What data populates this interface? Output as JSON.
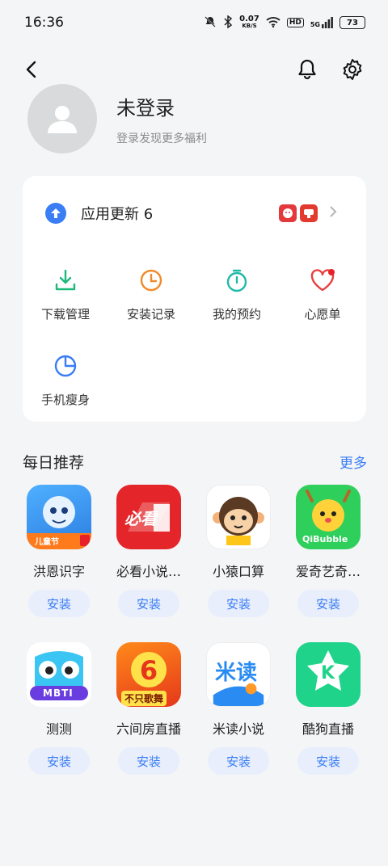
{
  "status": {
    "time": "16:36",
    "net_speed": "0.07",
    "net_unit": "KB/S",
    "hd": "HD",
    "signal": "5G",
    "battery": "73"
  },
  "profile": {
    "title": "未登录",
    "subtitle": "登录发现更多福利"
  },
  "update": {
    "label": "应用更新 6",
    "chips": [
      "京东",
      "百度"
    ]
  },
  "tools": [
    {
      "label": "下载管理",
      "icon": "download-icon",
      "color": "#1db97a"
    },
    {
      "label": "安装记录",
      "icon": "clock-icon",
      "color": "#f08a2a"
    },
    {
      "label": "我的预约",
      "icon": "timer-icon",
      "color": "#1fb9a8"
    },
    {
      "label": "心愿单",
      "icon": "heart-icon",
      "color": "#e84040"
    },
    {
      "label": "手机瘦身",
      "icon": "pie-icon",
      "color": "#3a7df5"
    }
  ],
  "daily": {
    "title": "每日推荐",
    "more": "更多",
    "apps": [
      {
        "name": "洪恩识字",
        "install": "安装",
        "icon_text": "儿童节"
      },
      {
        "name": "必看小说…",
        "install": "安装",
        "icon_text": "必看"
      },
      {
        "name": "小猿口算",
        "install": "安装",
        "icon_text": ""
      },
      {
        "name": "爱奇艺奇…",
        "install": "安装",
        "icon_text": "QiBubble"
      },
      {
        "name": "测测",
        "install": "安装",
        "icon_text": "MBTI"
      },
      {
        "name": "六间房直播",
        "install": "安装",
        "icon_text": "不只歌舞"
      },
      {
        "name": "米读小说",
        "install": "安装",
        "icon_text": "米读"
      },
      {
        "name": "酷狗直播",
        "install": "安装",
        "icon_text": "K"
      }
    ]
  },
  "colors": {
    "accent": "#3a7df5",
    "install_bg": "#e8eefc",
    "page_bg": "#f4f5f7"
  }
}
